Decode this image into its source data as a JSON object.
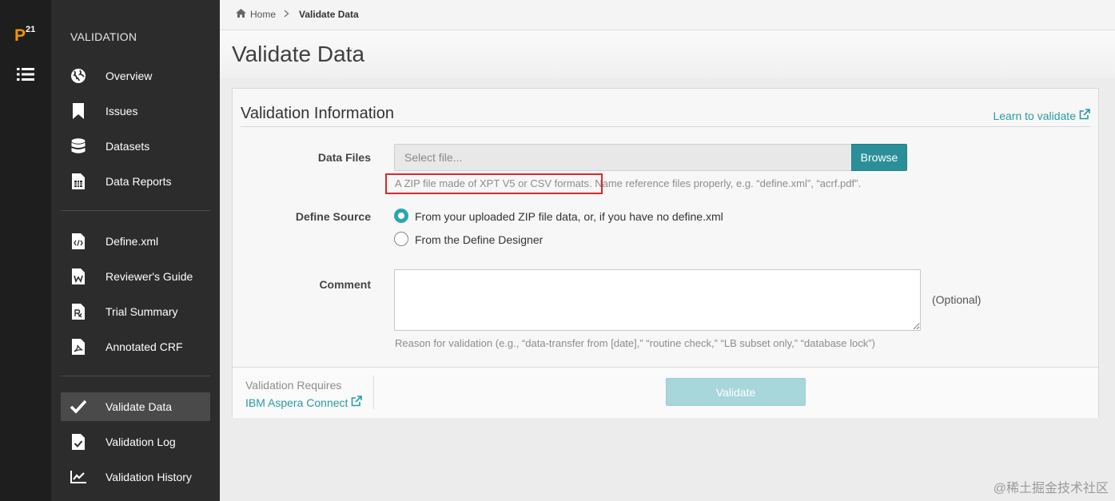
{
  "app": {
    "logo_letter": "P",
    "logo_super": "21"
  },
  "sidebar": {
    "heading": "VALIDATION",
    "items": [
      {
        "label": "Overview",
        "icon": "globe-icon"
      },
      {
        "label": "Issues",
        "icon": "bookmark-icon"
      },
      {
        "label": "Datasets",
        "icon": "database-icon"
      },
      {
        "label": "Data Reports",
        "icon": "report-icon"
      },
      {
        "label": "Define.xml",
        "icon": "code-file-icon"
      },
      {
        "label": "Reviewer's Guide",
        "icon": "word-file-icon"
      },
      {
        "label": "Trial Summary",
        "icon": "rx-file-icon"
      },
      {
        "label": "Annotated CRF",
        "icon": "pdf-file-icon"
      },
      {
        "label": "Validate Data",
        "icon": "check-icon",
        "active": true
      },
      {
        "label": "Validation Log",
        "icon": "check-file-icon"
      },
      {
        "label": "Validation History",
        "icon": "line-chart-icon"
      }
    ]
  },
  "breadcrumb": {
    "home": "Home",
    "current": "Validate Data"
  },
  "page": {
    "title": "Validate Data"
  },
  "panel": {
    "title": "Validation Information",
    "learn_link": "Learn to validate",
    "data_files": {
      "label": "Data Files",
      "placeholder": "Select file...",
      "browse": "Browse",
      "help_highlight": "A ZIP file made of XPT V5 or CSV formats.",
      "help_rest": " Name reference files properly, e.g. “define.xml”, “acrf.pdf”."
    },
    "define_source": {
      "label": "Define Source",
      "options": [
        {
          "label": "From your uploaded ZIP file data, or, if you have no define.xml",
          "checked": true
        },
        {
          "label": "From the Define Designer",
          "checked": false
        }
      ]
    },
    "comment": {
      "label": "Comment",
      "value": "",
      "optional": "(Optional)",
      "help": "Reason for validation (e.g., “data-transfer from [date],” “routine check,” “LB subset only,” “database lock”)"
    },
    "footer": {
      "requires": "Validation Requires",
      "aspera": "IBM Aspera Connect",
      "validate": "Validate"
    }
  },
  "watermark": "@稀土掘金技术社区",
  "colors": {
    "accent": "#2aa6b3",
    "logo": "#f39200",
    "highlight": "#d9282f"
  }
}
